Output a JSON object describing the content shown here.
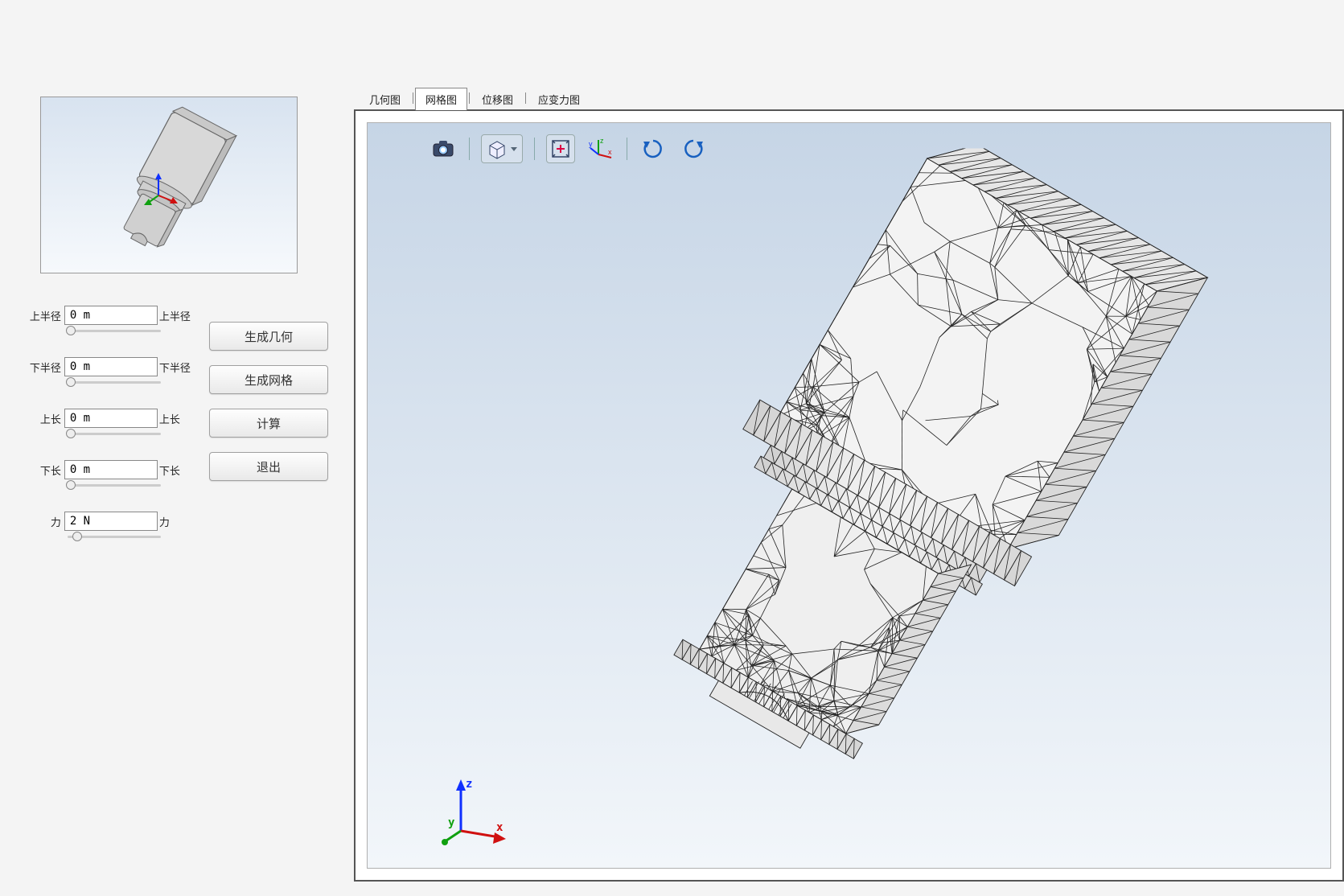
{
  "params": {
    "upper_radius": {
      "label": "上半径",
      "value": "0 m",
      "label_r": "上半径"
    },
    "lower_radius": {
      "label": "下半径",
      "value": "0 m",
      "label_r": "下半径"
    },
    "upper_length": {
      "label": "上长",
      "value": "0 m",
      "label_r": "上长"
    },
    "lower_length": {
      "label": "下长",
      "value": "0 m",
      "label_r": "下长"
    },
    "force": {
      "label": "力",
      "value": "2 N",
      "label_r": "力"
    }
  },
  "buttons": {
    "gen_geom": "生成几何",
    "gen_mesh": "生成网格",
    "compute": "计算",
    "exit": "退出"
  },
  "tabs": {
    "geom": "几何图",
    "mesh": "网格图",
    "disp": "位移图",
    "stress": "应变力图"
  },
  "active_tab": "mesh",
  "toolbar": {
    "camera": "camera-icon",
    "cube": "cube-view-icon",
    "fit": "fit-view-icon",
    "triad": "axis-triad-icon",
    "rotcw": "rotate-cw-icon",
    "rotccw": "rotate-ccw-icon"
  },
  "axes": {
    "x": "x",
    "y": "y",
    "z": "z"
  }
}
